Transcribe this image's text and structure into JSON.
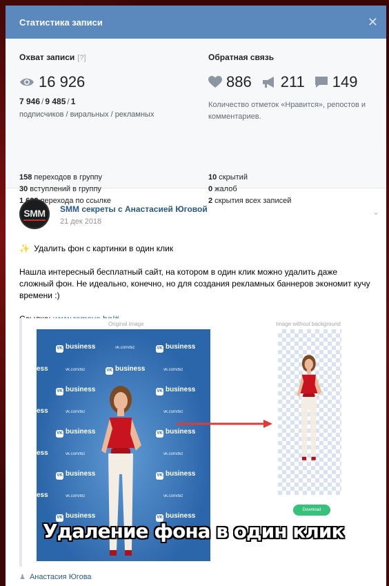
{
  "modal": {
    "title": "Статистика записи",
    "close_glyph": "✕"
  },
  "reach": {
    "label": "Охват записи",
    "help": "[?]",
    "views": "16 926",
    "breakdown": {
      "subscribers": "7 946",
      "viral": "9 485",
      "ads": "1",
      "sep": "/"
    },
    "breakdown_caption": "подписчиков / виральных / рекламных",
    "stats": [
      {
        "num": "158",
        "text": " переходов в группу"
      },
      {
        "num": "30",
        "text": " вступлений в группу"
      },
      {
        "num": "1 683",
        "text": " перехода по ссылке"
      }
    ]
  },
  "feedback": {
    "label": "Обратная связь",
    "likes": "886",
    "reposts": "211",
    "comments": "149",
    "description": "Количество отметок «Нравится», репостов и комментариев.",
    "stats": [
      {
        "num": "10",
        "text": " скрытий"
      },
      {
        "num": "0",
        "text": " жалоб"
      },
      {
        "num": "2",
        "text": " скрытия всех записей"
      }
    ]
  },
  "post": {
    "avatar_text": "SMM",
    "author": "SMM секреты с Анастасией Юговой",
    "date": "21 дек 2018",
    "line1_emoji": "✨",
    "line1": " Удалить фон с картинки в один клик",
    "paragraph": "Нашла интересный бесплатный сайт, на котором в один клик можно удалить даже сложный фон. Не идеально, конечно, но для создания рекламных баннеров экономит кучу времени :)",
    "link_prefix": "Ссылка: ",
    "link_text": "www.remove.bg/#",
    "image": {
      "caption_left": "Original image",
      "caption_right": "Image without background",
      "download_label": "Download",
      "banner_text": "Удаление фона в один клик",
      "tile_word": "business",
      "tile_url": "vk.com/biz",
      "tile_fragment": "ess"
    },
    "signer": "Анастасия Югова"
  },
  "colors": {
    "header": "#5b88bd",
    "link": "#2a5885",
    "arrow": "#e03a3a",
    "download": "#37c17a"
  }
}
